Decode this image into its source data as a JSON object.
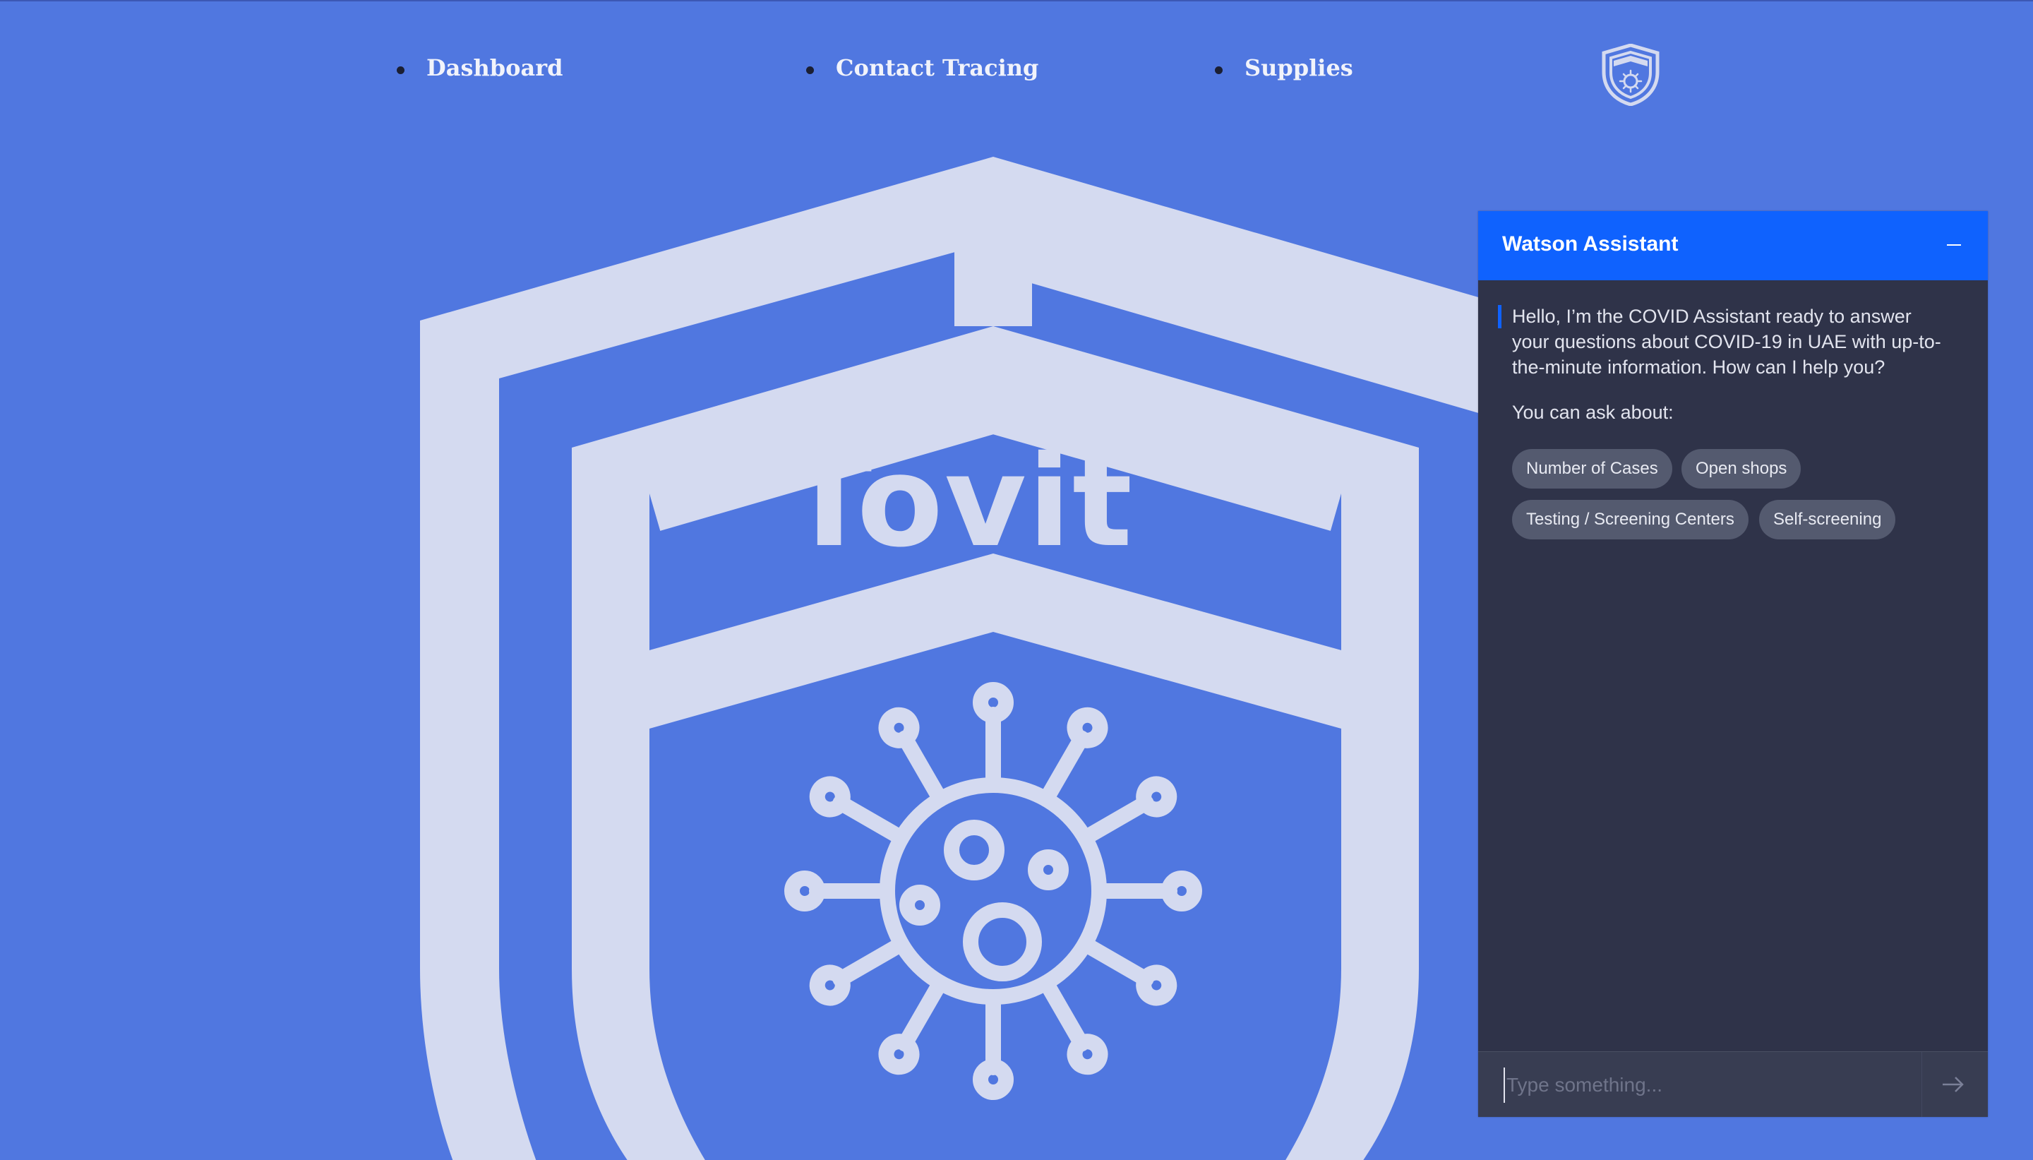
{
  "nav": {
    "items": [
      {
        "label": "Dashboard"
      },
      {
        "label": "Contact Tracing"
      },
      {
        "label": "Supplies"
      }
    ],
    "logo_icon": "shield-virus-icon"
  },
  "hero": {
    "title": "Tovit",
    "icon": "shield-virus-icon"
  },
  "chat": {
    "title": "Watson Assistant",
    "minimize_icon": "minus-icon",
    "message": "Hello, I’m the COVID Assistant ready to answer your questions about COVID-19 in UAE with up-to-the-minute information. How can I help you?",
    "ask_label": "You can ask about:",
    "suggestions": [
      {
        "label": "Number of Cases"
      },
      {
        "label": "Open shops"
      },
      {
        "label": "Testing / Screening Centers"
      },
      {
        "label": "Self-screening"
      }
    ],
    "input": {
      "value": "",
      "placeholder": "Type something..."
    },
    "send_icon": "arrow-right-icon"
  },
  "colors": {
    "background": "#5077e0",
    "shield": "#d4daf0",
    "chat_header": "#0f62fe",
    "chat_body": "#2f3349",
    "chip": "#545a6f"
  }
}
